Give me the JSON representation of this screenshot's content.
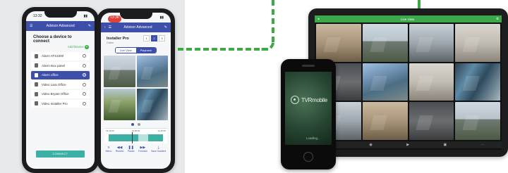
{
  "colors": {
    "brand_green": "#3daa47",
    "app_blue": "#3d4fa8",
    "teal": "#3cb0a4"
  },
  "phone1": {
    "status_time": "13:32",
    "app_title": "Advisor Advanced",
    "heading": "Choose a device to connect",
    "add_device": "Add Device",
    "devices": [
      {
        "label": "Alarm ATS1000",
        "selected": false
      },
      {
        "label": "Alarm Box panel",
        "selected": false
      },
      {
        "label": "Alarm office",
        "selected": true
      },
      {
        "label": "Video Lara Office",
        "selected": false
      },
      {
        "label": "Video Bryant Office",
        "selected": false
      },
      {
        "label": "Video Installer Pro",
        "selected": false
      }
    ],
    "connect_label": "CONNECT"
  },
  "phone2": {
    "status_time": "13:36",
    "app_title": "Advisor Advanced",
    "device_name": "Installer Pro",
    "device_sub": "Online",
    "pages": [
      "1",
      "2",
      "3"
    ],
    "tabs": [
      "Live View",
      "Playback"
    ],
    "timeline_labels": [
      "13:32:00",
      "14:00:00",
      "14:15:00"
    ],
    "controls": [
      "Menu",
      "Rewind",
      "Pause",
      "Forward",
      "Save Incident"
    ]
  },
  "tablet": {
    "title": "Live View"
  },
  "iphone4": {
    "brand": "TVRmobile",
    "loading": "Loading..."
  }
}
